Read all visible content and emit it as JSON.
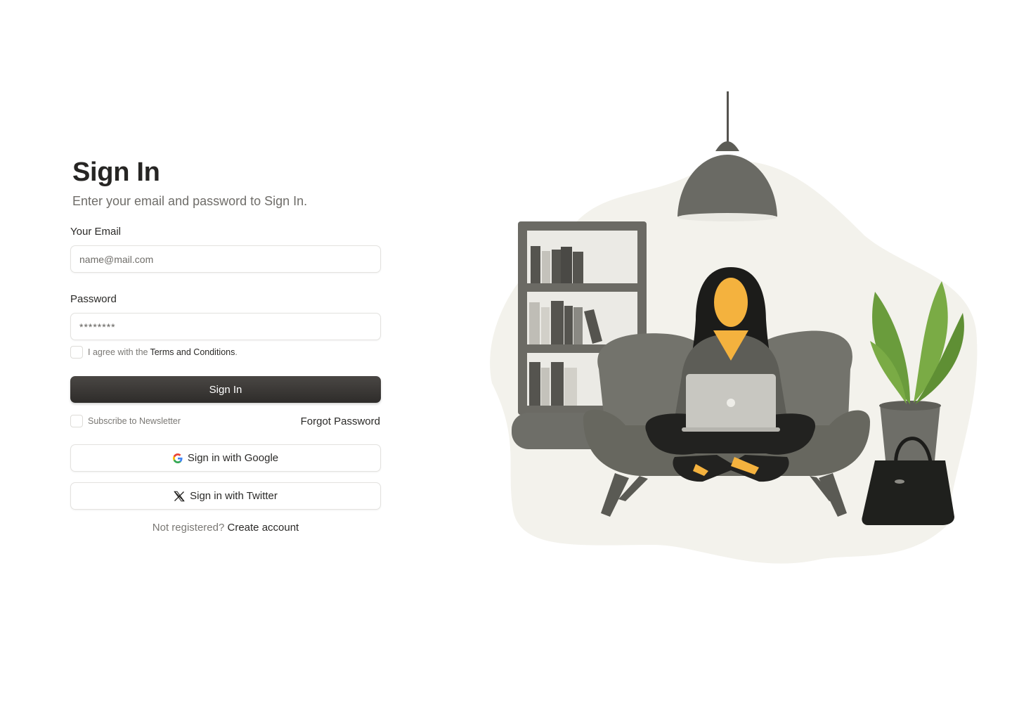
{
  "signin": {
    "title": "Sign In",
    "subtitle": "Enter your email and password to Sign In.",
    "email_label": "Your Email",
    "email_placeholder": "name@mail.com",
    "password_label": "Password",
    "password_value": "********",
    "terms_prefix": "I agree with the",
    "terms_link": "Terms and Conditions",
    "terms_suffix": ".",
    "submit_label": "Sign In",
    "newsletter_label": "Subscribe to Newsletter",
    "forgot_label": "Forgot Password",
    "google_label": "Sign in with Google",
    "twitter_label": "Sign in with Twitter",
    "register_prompt": "Not registered?",
    "register_link": "Create account"
  },
  "icons": {
    "google": "google-icon",
    "twitter": "x-twitter-icon"
  },
  "colors": {
    "primary_button": "#3a3835",
    "illustration_accent": "#f4b23e",
    "plant_green": "#6a9c3c",
    "sofa_gray": "#6e6e68",
    "blob_background": "#f3f2ec"
  }
}
